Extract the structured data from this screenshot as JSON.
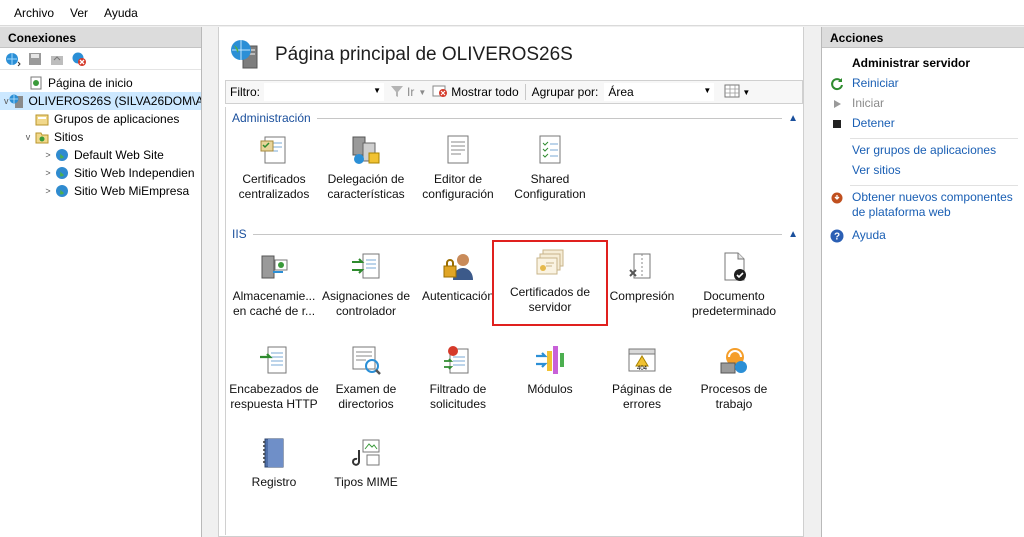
{
  "menu": [
    "Archivo",
    "Ver",
    "Ayuda"
  ],
  "connections": {
    "title": "Conexiones",
    "tree": [
      {
        "label": "Página de inicio",
        "level": 1,
        "expander": ""
      },
      {
        "label": "OLIVEROS26S (SILVA26DOM\\A",
        "level": 0,
        "expander": "v",
        "selected": true
      },
      {
        "label": "Grupos de aplicaciones",
        "level": 1,
        "expander": ""
      },
      {
        "label": "Sitios",
        "level": 1,
        "expander": "v"
      },
      {
        "label": "Default Web Site",
        "level": 2,
        "expander": ">"
      },
      {
        "label": "Sitio Web Independien",
        "level": 2,
        "expander": ">"
      },
      {
        "label": "Sitio Web MiEmpresa",
        "level": 2,
        "expander": ">"
      }
    ]
  },
  "center": {
    "title": "Página principal de OLIVEROS26S",
    "filter": {
      "label": "Filtro:",
      "go": "Ir",
      "show_all": "Mostrar todo",
      "group_label": "Agrupar por:",
      "group_value": "Área"
    },
    "sections": [
      {
        "name": "Administración",
        "features": [
          {
            "label": "Certificados centralizados",
            "icon": "certificates-icon"
          },
          {
            "label": "Delegación de características",
            "icon": "delegation-icon"
          },
          {
            "label": "Editor de configuración",
            "icon": "config-editor-icon"
          },
          {
            "label": "Shared Configuration",
            "icon": "shared-config-icon"
          }
        ]
      },
      {
        "name": "IIS",
        "features": [
          {
            "label": "Almacenamie... en caché de r...",
            "icon": "output-cache-icon"
          },
          {
            "label": "Asignaciones de controlador",
            "icon": "handler-mappings-icon"
          },
          {
            "label": "Autenticación",
            "icon": "authentication-icon"
          },
          {
            "label": "Certificados de servidor",
            "icon": "server-certificates-icon",
            "selected": true
          },
          {
            "label": "Compresión",
            "icon": "compression-icon"
          },
          {
            "label": "Documento predeterminado",
            "icon": "default-document-icon"
          },
          {
            "label": "Encabezados de respuesta HTTP",
            "icon": "http-headers-icon"
          },
          {
            "label": "Examen de directorios",
            "icon": "directory-browsing-icon"
          },
          {
            "label": "Filtrado de solicitudes",
            "icon": "request-filtering-icon"
          },
          {
            "label": "Módulos",
            "icon": "modules-icon"
          },
          {
            "label": "Páginas de errores",
            "icon": "error-pages-icon",
            "badge": "404"
          },
          {
            "label": "Procesos de trabajo",
            "icon": "worker-processes-icon"
          },
          {
            "label": "Registro",
            "icon": "logging-icon"
          },
          {
            "label": "Tipos MIME",
            "icon": "mime-types-icon"
          }
        ]
      }
    ]
  },
  "actions": {
    "title": "Acciones",
    "group_title": "Administrar servidor",
    "items": [
      {
        "label": "Reiniciar",
        "icon": "restart-icon",
        "disabled": false
      },
      {
        "label": "Iniciar",
        "icon": "start-icon",
        "disabled": true
      },
      {
        "label": "Detener",
        "icon": "stop-icon",
        "disabled": false
      },
      {
        "label": "Ver grupos de aplicaciones",
        "icon": "",
        "disabled": false
      },
      {
        "label": "Ver sitios",
        "icon": "",
        "disabled": false
      },
      {
        "label": "Obtener nuevos componentes de plataforma web",
        "icon": "web-platform-icon",
        "disabled": false
      },
      {
        "label": "Ayuda",
        "icon": "help-icon",
        "disabled": false
      }
    ]
  }
}
